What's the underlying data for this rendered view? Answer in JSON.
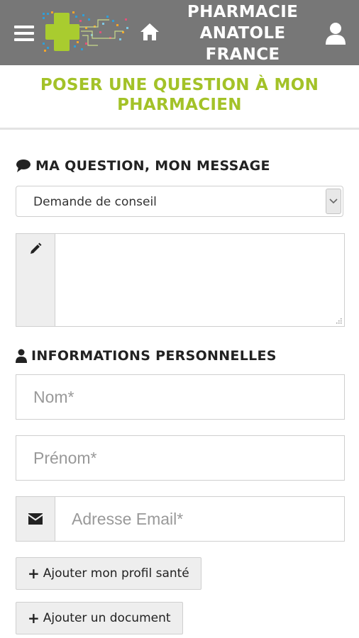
{
  "header": {
    "pharmacy_name_lines": [
      "PHARMACIE",
      "ANATOLE",
      "FRANCE"
    ],
    "menu_icon": "hamburger-icon",
    "home_icon": "home-icon",
    "account_icon": "user-icon",
    "background_color": "#777777"
  },
  "page": {
    "title_lines": [
      "POSER UNE QUESTION À MON",
      "PHARMACIEN"
    ],
    "title_color": "#a3c228"
  },
  "question_section": {
    "heading": "MA QUESTION, MON MESSAGE",
    "heading_icon": "comment-icon",
    "request_type": {
      "selected": "Demande de conseil"
    },
    "message": {
      "icon": "pencil-icon",
      "value": ""
    }
  },
  "personal_section": {
    "heading": "INFORMATIONS PERSONNELLES",
    "heading_icon": "user-icon",
    "last_name": {
      "placeholder": "Nom*",
      "value": ""
    },
    "first_name": {
      "placeholder": "Prénom*",
      "value": ""
    },
    "email": {
      "placeholder": "Adresse Email*",
      "value": "",
      "icon": "envelope-icon"
    }
  },
  "actions": {
    "add_health_profile": "Ajouter mon profil santé",
    "add_document": "Ajouter un document"
  }
}
